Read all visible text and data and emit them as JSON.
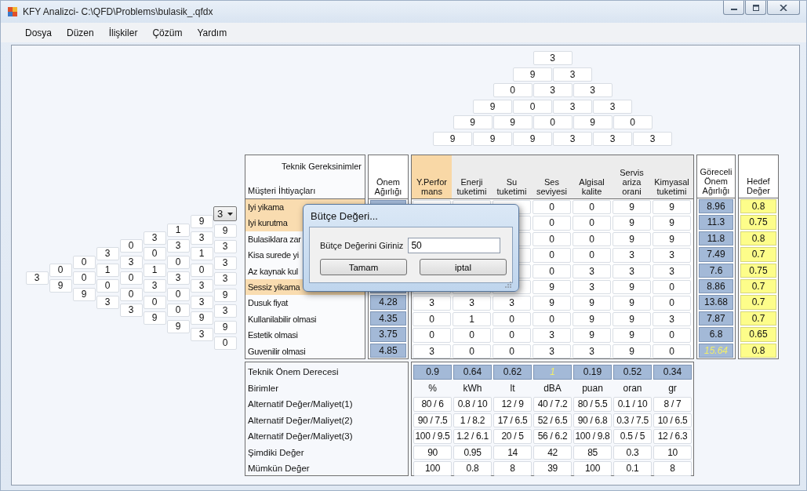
{
  "window": {
    "title": "KFY Analizci- C:\\QFD\\Problems\\bulasik_.qfdx"
  },
  "menu": [
    "Dosya",
    "Düzen",
    "İlişkiler",
    "Çözüm",
    "Yardım"
  ],
  "roof": [
    [
      "3"
    ],
    [
      "9",
      "3"
    ],
    [
      "0",
      "3",
      "3"
    ],
    [
      "9",
      "0",
      "3",
      "3"
    ],
    [
      "9",
      "9",
      "0",
      "9",
      "0"
    ],
    [
      "9",
      "9",
      "9",
      "3",
      "3",
      "3"
    ]
  ],
  "correlations": {
    "dropdown": "3",
    "columns": [
      [
        "3"
      ],
      [
        "0",
        "9"
      ],
      [
        "0",
        "0",
        "9"
      ],
      [
        "3",
        "1",
        "0",
        "3"
      ],
      [
        "0",
        "3",
        "0",
        "0",
        "3"
      ],
      [
        "3",
        "0",
        "1",
        "3",
        "0",
        "9"
      ],
      [
        "1",
        "3",
        "0",
        "3",
        "0",
        "0",
        "9"
      ],
      [
        "9",
        "3",
        "1",
        "0",
        "3",
        "3",
        "9",
        "3"
      ],
      [
        "9",
        "3",
        "3",
        "3",
        "9",
        "3",
        "9",
        "0"
      ]
    ]
  },
  "matrix": {
    "corner_top": "Teknik Gereksinimler",
    "corner_bottom": "Müşteri İhtiyaçları",
    "weight_header": "Önem Ağırlığı",
    "relative_header": "Göreceli Önem Ağırlığı",
    "target_header": "Hedef Değer",
    "requirements": [
      {
        "label": "Y.Perfor mans",
        "selected": true
      },
      {
        "label": "Enerji tuketimi",
        "selected": false
      },
      {
        "label": "Su tuketimi",
        "selected": false
      },
      {
        "label": "Ses seviyesi",
        "selected": false
      },
      {
        "label": "Algisal kalite",
        "selected": false
      },
      {
        "label": "Servis ariza orani",
        "selected": false
      },
      {
        "label": "Kimyasal tuketimi",
        "selected": false
      }
    ],
    "needs": [
      {
        "name": "Iyi yikama",
        "selected": true,
        "relations": [
          "0",
          "0",
          "9",
          "9"
        ],
        "relative": "8.96",
        "relative_highlighted": false,
        "target": "0.8"
      },
      {
        "name": "Iyi kurutma",
        "selected": true,
        "relations": [
          "0",
          "0",
          "9",
          "9"
        ],
        "relative": "11.3",
        "relative_highlighted": false,
        "target": "0.75"
      },
      {
        "name": "Bulasiklara zar",
        "selected": false,
        "relations": [
          "0",
          "0",
          "9",
          "9"
        ],
        "relative": "11.8",
        "relative_highlighted": false,
        "target": "0.8"
      },
      {
        "name": "Kisa surede yi",
        "selected": false,
        "relations": [
          "0",
          "0",
          "3",
          "3"
        ],
        "relative": "7.49",
        "relative_highlighted": false,
        "target": "0.7"
      },
      {
        "name": "Az kaynak kul",
        "selected": false,
        "relations": [
          "0",
          "3",
          "3",
          "3"
        ],
        "relative": "7.6",
        "relative_highlighted": false,
        "target": "0.75"
      },
      {
        "name": "Sessiz yikama",
        "selected": true,
        "relations": [
          "9",
          "3",
          "9",
          "0"
        ],
        "relative": "8.86",
        "relative_highlighted": false,
        "target": "0.7"
      },
      {
        "name": "Dusuk fiyat",
        "selected": false,
        "weight": "4.28",
        "weight_highlighted": false,
        "relations": [
          "3",
          "3",
          "3",
          "9",
          "9",
          "9",
          "0"
        ],
        "relative": "13.68",
        "relative_highlighted": false,
        "target": "0.7"
      },
      {
        "name": "Kullanilabilir olmasi",
        "selected": false,
        "weight": "4.35",
        "weight_highlighted": false,
        "relations": [
          "0",
          "1",
          "0",
          "0",
          "9",
          "9",
          "3"
        ],
        "relative": "7.87",
        "relative_highlighted": false,
        "target": "0.7"
      },
      {
        "name": "Estetik olmasi",
        "selected": false,
        "weight": "3.75",
        "weight_highlighted": false,
        "relations": [
          "0",
          "0",
          "0",
          "3",
          "9",
          "9",
          "0"
        ],
        "relative": "6.8",
        "relative_highlighted": false,
        "target": "0.65"
      },
      {
        "name": "Guvenilir olmasi",
        "selected": false,
        "weight": "4.85",
        "weight_highlighted": false,
        "relations": [
          "3",
          "0",
          "0",
          "3",
          "3",
          "9",
          "0"
        ],
        "relative": "15.64",
        "relative_highlighted": true,
        "target": "0.8"
      }
    ]
  },
  "summary": {
    "rows": [
      {
        "label": "Teknik Önem Derecesi",
        "kind": "importance",
        "values": [
          "0.9",
          "0.64",
          "0.62",
          "1",
          "0.19",
          "0.52",
          "0.34"
        ],
        "highlighted": [
          false,
          false,
          false,
          true,
          false,
          false,
          false
        ]
      },
      {
        "label": "Birimler",
        "kind": "units",
        "values": [
          "%",
          "kWh",
          "lt",
          "dBA",
          "puan",
          "oran",
          "gr"
        ]
      },
      {
        "label": "Alternatif Değer/Maliyet(1)",
        "kind": "value",
        "values": [
          "80 / 6",
          "0.8 / 10",
          "12 / 9",
          "40 / 7.2",
          "80 / 5.5",
          "0.1 / 10",
          "8 / 7"
        ]
      },
      {
        "label": "Alternatif Değer/Maliyet(2)",
        "kind": "value",
        "values": [
          "90 / 7.5",
          "1 / 8.2",
          "17 / 6.5",
          "52 / 6.5",
          "90 / 6.8",
          "0.3 / 7.5",
          "10 / 6.5"
        ]
      },
      {
        "label": "Alternatif Değer/Maliyet(3)",
        "kind": "value",
        "values": [
          "100 / 9.5",
          "1.2 / 6.1",
          "20 / 5",
          "56 / 6.2",
          "100 / 9.8",
          "0.5 / 5",
          "12 / 6.3"
        ]
      },
      {
        "label": "Şimdiki Değer",
        "kind": "value",
        "values": [
          "90",
          "0.95",
          "14",
          "42",
          "85",
          "0.3",
          "10"
        ]
      },
      {
        "label": "Mümkün Değer",
        "kind": "value",
        "values": [
          "100",
          "0.8",
          "8",
          "39",
          "100",
          "0.1",
          "8"
        ]
      }
    ]
  },
  "dialog": {
    "title": "Bütçe Değeri...",
    "label": "Bütçe Değerini Giriniz",
    "value": "50",
    "buttons": [
      "Tamam",
      "iptal"
    ]
  }
}
